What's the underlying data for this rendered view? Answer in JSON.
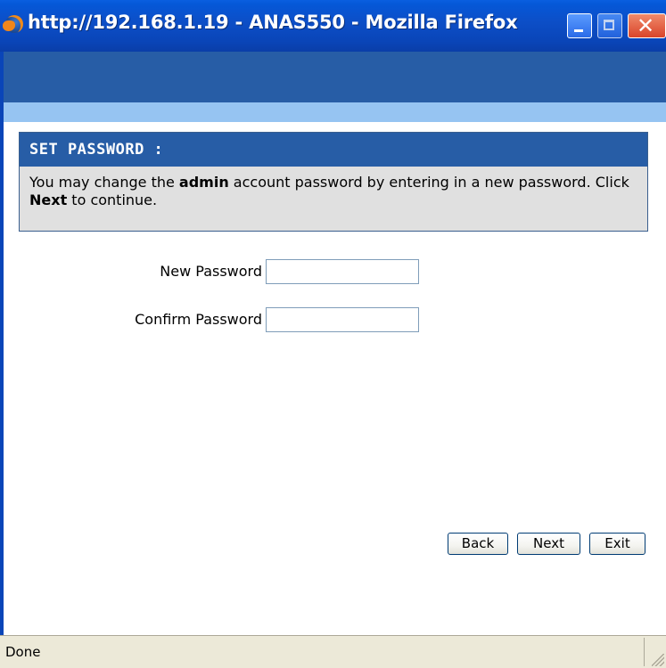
{
  "window": {
    "title": "http://192.168.1.19 - ANAS550 - Mozilla Firefox",
    "icon": "firefox-icon",
    "controls": {
      "minimize": "minimize-icon",
      "maximize": "maximize-icon",
      "close_glyph": "✕"
    }
  },
  "panel": {
    "title": "SET PASSWORD :",
    "text_1": "You may change the ",
    "text_bold_1": "admin",
    "text_2": " account password by entering in a new password. Click ",
    "text_bold_2": "Next",
    "text_3": " to continue."
  },
  "form": {
    "new_password_label": "New Password",
    "new_password_value": "",
    "confirm_password_label": "Confirm Password",
    "confirm_password_value": ""
  },
  "buttons": {
    "back": "Back",
    "next": "Next",
    "exit": "Exit"
  },
  "status": {
    "text": "Done"
  },
  "colors": {
    "titlebar": "#0a45b8",
    "header_band": "#275da6",
    "light_band": "#96c4f2",
    "panel_bg": "#e0e0e0",
    "statusbar": "#ece9d8"
  }
}
